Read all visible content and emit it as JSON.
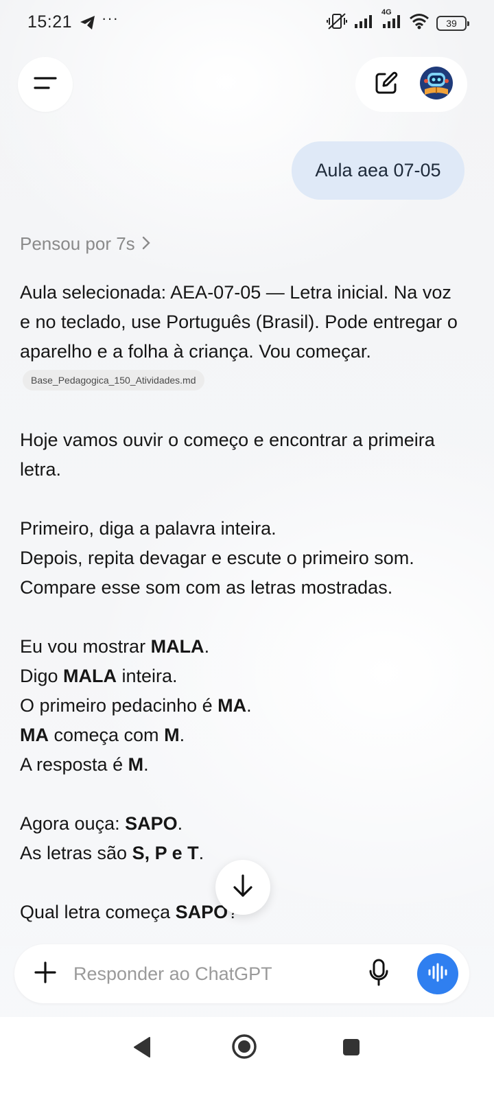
{
  "status_bar": {
    "time": "15:21",
    "more": "···",
    "battery": "39",
    "network": "4G"
  },
  "header": {
    "menu_icon": "menu-icon",
    "new_chat_icon": "edit-icon",
    "gpt_icon": "custom-gpt-avatar"
  },
  "user_message": "Aula aea 07-05",
  "thought": {
    "label": "Pensou por 7s",
    "chevron": "›"
  },
  "assistant": {
    "p1": {
      "text": "Aula selecionada: AEA-07-05 — Letra inicial. Na voz e no teclado, use Português (Brasil). Pode entregar o aparelho e a folha à criança. Vou começar.",
      "source": "Base_Pedagogica_150_Atividades.md"
    },
    "p2": "Hoje vamos ouvir o começo e encontrar a primeira letra.",
    "p3": [
      "Primeiro, diga a palavra inteira.",
      "Depois, repita devagar e escute o primeiro som.",
      "Compare esse som com as letras mostradas."
    ],
    "p4": {
      "l1_a": "Eu vou mostrar ",
      "l1_b": "MALA",
      "l1_c": ".",
      "l2_a": "Digo ",
      "l2_b": "MALA",
      "l2_c": " inteira.",
      "l3_a": "O primeiro pedacinho é ",
      "l3_b": "MA",
      "l3_c": ".",
      "l4_a": "MA",
      "l4_b": " começa com ",
      "l4_c": "M",
      "l4_d": ".",
      "l5_a": "A resposta é ",
      "l5_b": "M",
      "l5_c": "."
    },
    "p5": {
      "l1_a": "Agora ouça: ",
      "l1_b": "SAPO",
      "l1_c": ".",
      "l2_a": "As letras são ",
      "l2_b": "S, P e T",
      "l2_c": "."
    },
    "p6": {
      "a": "Qual letra começa ",
      "b": "SAPO",
      "c": "?"
    }
  },
  "composer": {
    "placeholder": "Responder ao ChatGPT",
    "value": ""
  },
  "colors": {
    "user_bubble": "#dfe9f7",
    "voice_button": "#2f7ff0",
    "background": "#f6f7f9"
  }
}
